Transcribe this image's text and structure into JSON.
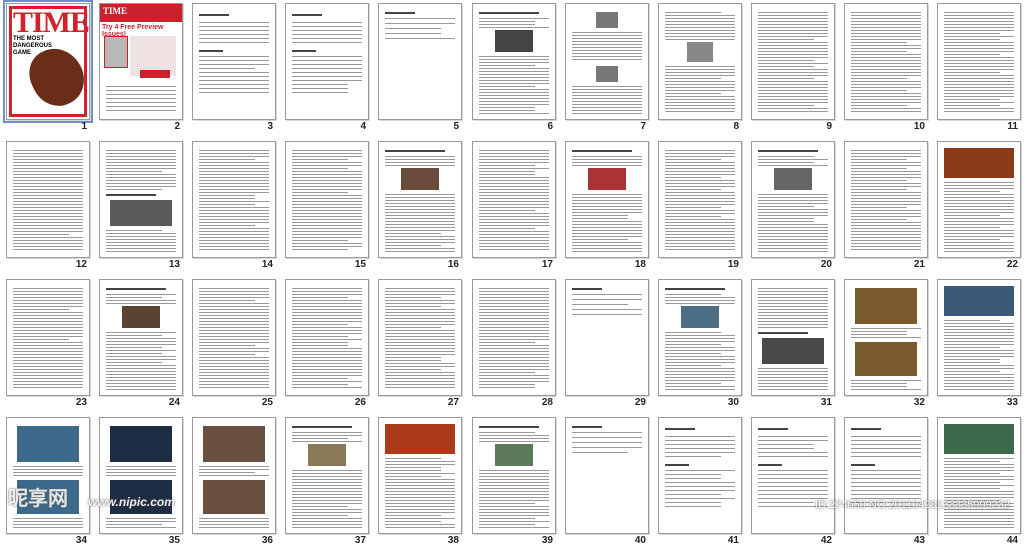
{
  "pages": [
    {
      "n": "1",
      "kind": "cover",
      "selected": true
    },
    {
      "n": "2",
      "kind": "promo"
    },
    {
      "n": "3",
      "kind": "toc"
    },
    {
      "n": "4",
      "kind": "toc"
    },
    {
      "n": "5",
      "kind": "toc-short"
    },
    {
      "n": "6",
      "kind": "article-photo",
      "img": "#444"
    },
    {
      "n": "7",
      "kind": "two-photo",
      "img": "#777"
    },
    {
      "n": "8",
      "kind": "text-photo",
      "img": "#888"
    },
    {
      "n": "9",
      "kind": "text"
    },
    {
      "n": "10",
      "kind": "text"
    },
    {
      "n": "11",
      "kind": "text"
    },
    {
      "n": "12",
      "kind": "text"
    },
    {
      "n": "13",
      "kind": "text-photo-low",
      "img": "#5b5b5b"
    },
    {
      "n": "14",
      "kind": "text"
    },
    {
      "n": "15",
      "kind": "text"
    },
    {
      "n": "16",
      "kind": "article-photo",
      "img": "#6a4a3a"
    },
    {
      "n": "17",
      "kind": "text"
    },
    {
      "n": "18",
      "kind": "article-photo",
      "img": "#a33"
    },
    {
      "n": "19",
      "kind": "text"
    },
    {
      "n": "20",
      "kind": "article-photo",
      "img": "#666"
    },
    {
      "n": "21",
      "kind": "text"
    },
    {
      "n": "22",
      "kind": "top-photo",
      "img": "#8a3b1a"
    },
    {
      "n": "23",
      "kind": "text"
    },
    {
      "n": "24",
      "kind": "article-photo",
      "img": "#5a4330"
    },
    {
      "n": "25",
      "kind": "text"
    },
    {
      "n": "26",
      "kind": "text"
    },
    {
      "n": "27",
      "kind": "text"
    },
    {
      "n": "28",
      "kind": "text"
    },
    {
      "n": "29",
      "kind": "toc-short"
    },
    {
      "n": "30",
      "kind": "article-photo",
      "img": "#4d6f86"
    },
    {
      "n": "31",
      "kind": "text-photo-low",
      "img": "#4a4a4a"
    },
    {
      "n": "32",
      "kind": "two-photo-big",
      "img": "#7a5a2c"
    },
    {
      "n": "33",
      "kind": "top-photo",
      "img": "#3c5a78"
    },
    {
      "n": "34",
      "kind": "two-photo-big",
      "img": "#3d6a8a"
    },
    {
      "n": "35",
      "kind": "two-photo-big",
      "img": "#1e2c44"
    },
    {
      "n": "36",
      "kind": "two-photo-big",
      "img": "#6a5040"
    },
    {
      "n": "37",
      "kind": "article-photo",
      "img": "#8a7a5a"
    },
    {
      "n": "38",
      "kind": "top-photo",
      "img": "#aa3a1a"
    },
    {
      "n": "39",
      "kind": "article-photo",
      "img": "#5a7a5a"
    },
    {
      "n": "40",
      "kind": "toc-short"
    },
    {
      "n": "41",
      "kind": "toc"
    },
    {
      "n": "42",
      "kind": "toc"
    },
    {
      "n": "43",
      "kind": "toc"
    },
    {
      "n": "44",
      "kind": "top-photo",
      "img": "#3a6a4a"
    }
  ],
  "cover": {
    "logo": "TIME",
    "headline": "THE MOST DANGEROUS GAME"
  },
  "promo": {
    "logo": "TIME",
    "title": "Try 4 Free Preview Issues!"
  },
  "watermark": {
    "text": "昵享网",
    "url": "www.nipic.com",
    "id": "ID:274650 NO:20110428133335999232"
  }
}
